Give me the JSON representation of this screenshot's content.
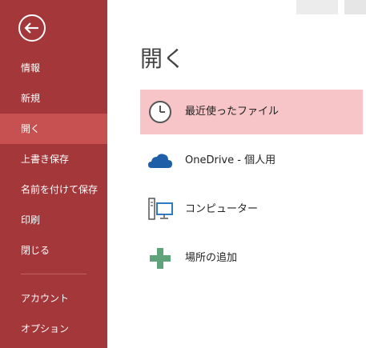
{
  "sidebar": {
    "back_icon": "back-arrow-icon",
    "items": [
      {
        "label": "情報"
      },
      {
        "label": "新規"
      },
      {
        "label": "開く",
        "active": true
      },
      {
        "label": "上書き保存"
      },
      {
        "label": "名前を付けて保存"
      },
      {
        "label": "印刷"
      },
      {
        "label": "閉じる"
      },
      {
        "label": "アカウント"
      },
      {
        "label": "オプション"
      }
    ]
  },
  "main": {
    "title": "開く",
    "locations": [
      {
        "label": "最近使ったファイル",
        "icon": "clock-icon",
        "selected": true
      },
      {
        "label": "OneDrive - 個人用",
        "icon": "cloud-icon"
      },
      {
        "label": "コンピューター",
        "icon": "computer-icon"
      },
      {
        "label": "場所の追加",
        "icon": "plus-icon"
      }
    ]
  },
  "colors": {
    "sidebar_bg": "#a4373a",
    "sidebar_active": "#c75050",
    "selected_item_bg": "#f7c5c7",
    "onedrive_blue": "#1f5fa8",
    "add_green": "#5fa37a"
  }
}
